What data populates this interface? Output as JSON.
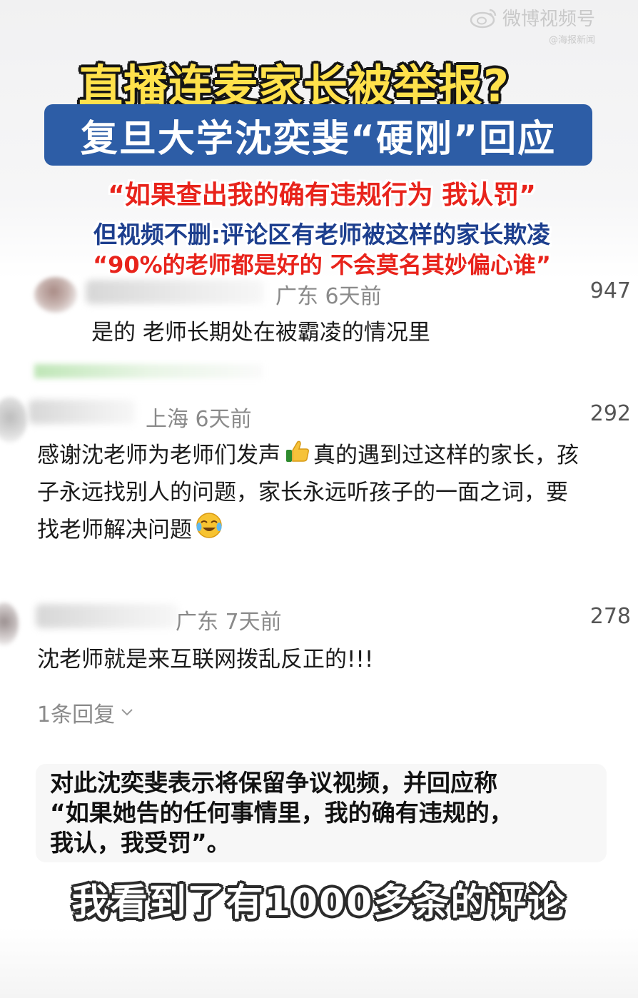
{
  "watermark": {
    "brand": "微博视频号",
    "sub": "@海报新闻"
  },
  "headline": {
    "title": "直播连麦家长被举报?",
    "subhead": "复旦大学沈奕斐“硬刚”回应"
  },
  "highlights": {
    "quote": "“如果查出我的确有违规行为 我认罚”",
    "line2": "但视频不删:评论区有老师被这样的家长欺凌",
    "line3": "“90%的老师都是好的 不会莫名其妙偏心谁”"
  },
  "comments": [
    {
      "location_time": "广东 6天前",
      "likes": "947",
      "lines": [
        "是的 老师长期处在被霸凌的情况里"
      ]
    },
    {
      "location_time": "上海 6天前",
      "likes": "292",
      "lines": [
        "感谢沈老师为老师们发声",
        "真的遇到过这样的家长，孩",
        "子永远找别人的问题，家长永远听孩子的一面之词，要",
        "找老师解决问题"
      ]
    },
    {
      "location_time": "广东 7天前",
      "likes": "278",
      "lines": [
        "沈老师就是来互联网拨乱反正的!!!"
      ],
      "reply_toggle": "1条回复"
    }
  ],
  "caption": {
    "lines": [
      "对此沈奕斐表示将保留争议视频，并回应称",
      "“如果她告的任何事情里，我的确有违规的，",
      "我认，我受罚”。"
    ]
  },
  "subtitle": "我看到了有1000多条的评论",
  "colors": {
    "headline_yellow": "#ffe14b",
    "subhead_blue": "#2d5da6",
    "accent_red": "#e8231b",
    "deep_blue": "#1d3f8e"
  },
  "icons": [
    "weibo-icon",
    "thumbs-up-emoji",
    "crying-laugh-emoji",
    "chevron-down-icon"
  ]
}
